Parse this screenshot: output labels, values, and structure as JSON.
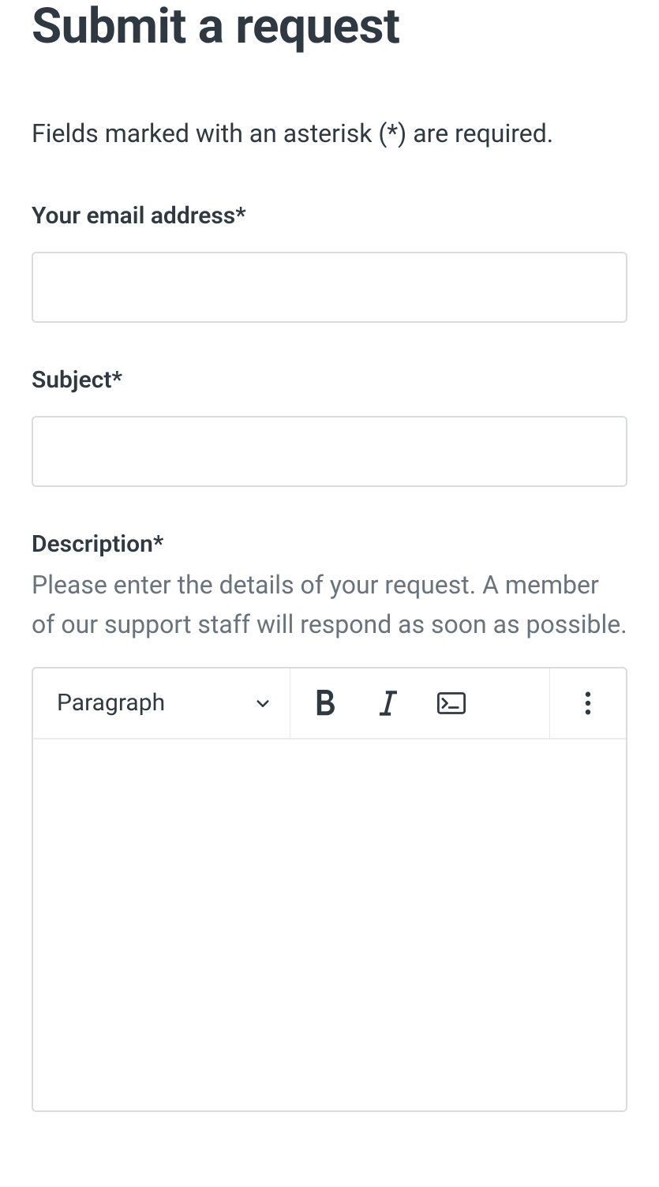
{
  "page": {
    "title": "Submit a request",
    "intro": "Fields marked with an asterisk (*) are required."
  },
  "fields": {
    "email": {
      "label": "Your email address*",
      "value": ""
    },
    "subject": {
      "label": "Subject*",
      "value": ""
    },
    "description": {
      "label": "Description*",
      "help": "Please enter the details of your request. A member of our support staff will respond as soon as possible.",
      "value": ""
    }
  },
  "editor": {
    "heading_selector": {
      "label": "Paragraph"
    },
    "buttons": {
      "bold": "Bold",
      "italic": "Italic",
      "code_block": "Code block",
      "more": "More"
    }
  }
}
